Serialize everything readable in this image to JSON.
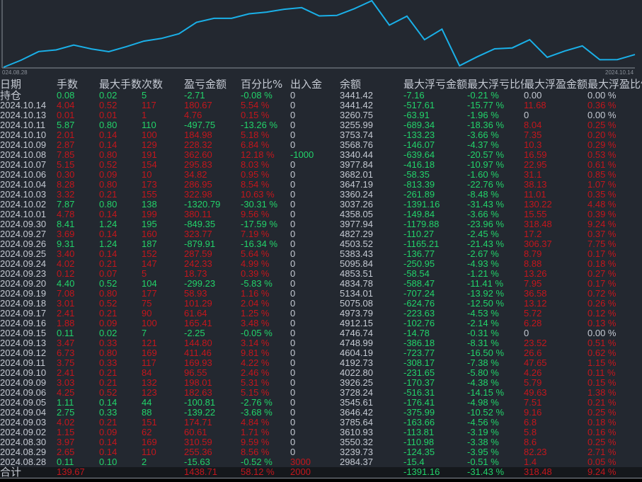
{
  "colors": {
    "bg": "#232830",
    "text": "#c5cad3",
    "up": "#c4161c",
    "down": "#22d36a",
    "line": "#1ab0e8",
    "total_bg": "#15181c"
  },
  "chart_data": {
    "type": "line",
    "title": "",
    "x_start_label": "024.08.28",
    "x_end_label": "2024.10.14",
    "series": [
      {
        "name": "余额",
        "source": "balance column (chronological)"
      }
    ],
    "grid": false
  },
  "headers": [
    "日期",
    "手数",
    "最大手数",
    "次数",
    "盈亏金额",
    "百分比%",
    "出入金",
    "余额",
    "最大浮亏金额",
    "最大浮亏比例",
    "最大浮盈金额",
    "最大浮盈比例"
  ],
  "rows": [
    [
      "持仓",
      "0.08",
      "0.02",
      "5",
      "-2.71",
      "-0.08 %",
      "0",
      "3441.42",
      "-7.16",
      "-0.21 %",
      "0.00",
      "0.00 %"
    ],
    [
      "2024.10.14",
      "4.04",
      "0.52",
      "117",
      "180.67",
      "5.54 %",
      "0",
      "3441.42",
      "-517.61",
      "-15.77 %",
      "11.68",
      "0.36 %"
    ],
    [
      "2024.10.13",
      "0.01",
      "0.01",
      "1",
      "4.76",
      "0.15 %",
      "0",
      "3260.75",
      "-63.91",
      "-1.96 %",
      "0",
      "0.00 %"
    ],
    [
      "2024.10.11",
      "5.87",
      "0.80",
      "110",
      "-497.75",
      "-13.26 %",
      "0",
      "3255.99",
      "-689.34",
      "-18.36 %",
      "8.04",
      "0.25 %"
    ],
    [
      "2024.10.10",
      "2.01",
      "0.14",
      "100",
      "184.98",
      "5.18 %",
      "0",
      "3753.74",
      "-133.23",
      "-3.66 %",
      "7.35",
      "0.20 %"
    ],
    [
      "2024.10.09",
      "2.87",
      "0.14",
      "129",
      "228.32",
      "6.84 %",
      "0",
      "3568.76",
      "-146.07",
      "-4.37 %",
      "10.3",
      "0.29 %"
    ],
    [
      "2024.10.08",
      "7.85",
      "0.80",
      "191",
      "362.60",
      "12.18 %",
      "-1000",
      "3340.44",
      "-639.64",
      "-20.57 %",
      "16.59",
      "0.53 %"
    ],
    [
      "2024.10.07",
      "5.15",
      "0.52",
      "154",
      "295.83",
      "8.03 %",
      "0",
      "3977.84",
      "-416.18",
      "-10.97 %",
      "22.95",
      "0.61 %"
    ],
    [
      "2024.10.06",
      "0.30",
      "0.09",
      "10",
      "34.82",
      "0.95 %",
      "0",
      "3682.01",
      "-58.35",
      "-1.60 %",
      "31.1",
      "0.85 %"
    ],
    [
      "2024.10.04",
      "8.28",
      "0.80",
      "173",
      "286.95",
      "8.54 %",
      "0",
      "3647.19",
      "-813.39",
      "-22.76 %",
      "38.13",
      "1.07 %"
    ],
    [
      "2024.10.03",
      "3.32",
      "0.21",
      "155",
      "322.98",
      "10.63 %",
      "0",
      "3360.24",
      "-261.89",
      "-8.48 %",
      "11.01",
      "0.35 %"
    ],
    [
      "2024.10.02",
      "7.87",
      "0.80",
      "138",
      "-1320.79",
      "-30.31 %",
      "0",
      "3037.26",
      "-1391.16",
      "-31.43 %",
      "130.22",
      "4.48 %"
    ],
    [
      "2024.10.01",
      "4.78",
      "0.14",
      "199",
      "380.11",
      "9.56 %",
      "0",
      "4358.05",
      "-149.84",
      "-3.66 %",
      "15.55",
      "0.39 %"
    ],
    [
      "2024.09.30",
      "8.41",
      "1.24",
      "195",
      "-849.35",
      "-17.59 %",
      "0",
      "3977.94",
      "-1179.88",
      "-23.96 %",
      "318.48",
      "9.24 %"
    ],
    [
      "2024.09.27",
      "3.69",
      "0.14",
      "160",
      "323.77",
      "7.19 %",
      "0",
      "4827.29",
      "-110.27",
      "-2.45 %",
      "17.2",
      "0.37 %"
    ],
    [
      "2024.09.26",
      "9.31",
      "1.24",
      "187",
      "-879.91",
      "-16.34 %",
      "0",
      "4503.52",
      "-1165.21",
      "-21.43 %",
      "306.37",
      "7.75 %"
    ],
    [
      "2024.09.25",
      "3.40",
      "0.14",
      "152",
      "287.59",
      "5.64 %",
      "0",
      "5383.43",
      "-136.77",
      "-2.67 %",
      "8.79",
      "0.17 %"
    ],
    [
      "2024.09.24",
      "4.02",
      "0.21",
      "147",
      "242.33",
      "4.99 %",
      "0",
      "5095.84",
      "-250.95",
      "-4.93 %",
      "8.88",
      "0.18 %"
    ],
    [
      "2024.09.23",
      "0.12",
      "0.07",
      "5",
      "18.73",
      "0.39 %",
      "0",
      "4853.51",
      "-58.54",
      "-1.21 %",
      "13.26",
      "0.27 %"
    ],
    [
      "2024.09.20",
      "4.40",
      "0.52",
      "104",
      "-299.23",
      "-5.83 %",
      "0",
      "4834.78",
      "-588.47",
      "-11.41 %",
      "7.95",
      "0.17 %"
    ],
    [
      "2024.09.19",
      "7.08",
      "0.80",
      "177",
      "58.93",
      "1.16 %",
      "0",
      "5134.01",
      "-707.24",
      "-13.92 %",
      "36.58",
      "0.72 %"
    ],
    [
      "2024.09.18",
      "3.01",
      "0.52",
      "75",
      "101.29",
      "2.04 %",
      "0",
      "5075.08",
      "-624.76",
      "-12.50 %",
      "13.12",
      "0.26 %"
    ],
    [
      "2024.09.17",
      "2.41",
      "0.21",
      "90",
      "61.64",
      "1.25 %",
      "0",
      "4973.79",
      "-223.63",
      "-4.53 %",
      "5.72",
      "0.12 %"
    ],
    [
      "2024.09.16",
      "1.88",
      "0.09",
      "100",
      "165.41",
      "3.48 %",
      "0",
      "4912.15",
      "-102.76",
      "-2.14 %",
      "6.28",
      "0.13 %"
    ],
    [
      "2024.09.15",
      "0.11",
      "0.02",
      "7",
      "-2.25",
      "-0.05 %",
      "0",
      "4746.74",
      "-14.78",
      "-0.31 %",
      "0",
      "0.00 %"
    ],
    [
      "2024.09.13",
      "3.47",
      "0.33",
      "121",
      "144.80",
      "3.14 %",
      "0",
      "4748.99",
      "-386.18",
      "-8.31 %",
      "23.52",
      "0.51 %"
    ],
    [
      "2024.09.12",
      "6.73",
      "0.80",
      "169",
      "411.46",
      "9.81 %",
      "0",
      "4604.19",
      "-723.77",
      "-16.50 %",
      "26.6",
      "0.62 %"
    ],
    [
      "2024.09.11",
      "3.75",
      "0.33",
      "117",
      "169.93",
      "4.22 %",
      "0",
      "4192.73",
      "-308.17",
      "-7.38 %",
      "47.65",
      "1.15 %"
    ],
    [
      "2024.09.10",
      "2.41",
      "0.21",
      "84",
      "96.55",
      "2.46 %",
      "0",
      "4022.80",
      "-231.65",
      "-5.80 %",
      "4.26",
      "0.11 %"
    ],
    [
      "2024.09.09",
      "3.03",
      "0.21",
      "132",
      "198.01",
      "5.31 %",
      "0",
      "3926.25",
      "-170.37",
      "-4.38 %",
      "5.79",
      "0.15 %"
    ],
    [
      "2024.09.06",
      "4.25",
      "0.52",
      "123",
      "182.63",
      "5.15 %",
      "0",
      "3728.24",
      "-516.31",
      "-14.15 %",
      "49.63",
      "1.38 %"
    ],
    [
      "2024.09.05",
      "1.11",
      "0.14",
      "44",
      "-100.81",
      "-2.76 %",
      "0",
      "3545.61",
      "-176.41",
      "-4.98 %",
      "7.51",
      "0.21 %"
    ],
    [
      "2024.09.04",
      "2.75",
      "0.33",
      "88",
      "-139.22",
      "-3.68 %",
      "0",
      "3646.42",
      "-375.99",
      "-10.52 %",
      "9.16",
      "0.25 %"
    ],
    [
      "2024.09.03",
      "4.02",
      "0.21",
      "151",
      "174.71",
      "4.84 %",
      "0",
      "3785.64",
      "-163.66",
      "-4.56 %",
      "6.8",
      "0.18 %"
    ],
    [
      "2024.09.02",
      "1.15",
      "0.09",
      "62",
      "60.61",
      "1.71 %",
      "0",
      "3610.93",
      "-113.81",
      "-3.19 %",
      "5.8",
      "0.16 %"
    ],
    [
      "2024.08.30",
      "3.97",
      "0.14",
      "169",
      "310.59",
      "9.59 %",
      "0",
      "3550.32",
      "-110.98",
      "-3.38 %",
      "8.6",
      "0.25 %"
    ],
    [
      "2024.08.29",
      "2.65",
      "0.14",
      "110",
      "255.36",
      "8.56 %",
      "0",
      "3239.73",
      "-124.35",
      "-3.95 %",
      "82.23",
      "2.71 %"
    ],
    [
      "2024.08.28",
      "0.11",
      "0.10",
      "2",
      "-15.63",
      "-0.52 %",
      "3000",
      "2984.37",
      "-15.4",
      "-0.51 %",
      "1.4",
      "0.05 %"
    ]
  ],
  "total": [
    "合计",
    "139.67",
    "",
    "",
    "1438.71",
    "58.12 %",
    "2000",
    "",
    "-1391.16",
    "-31.43 %",
    "318.48",
    "9.24 %"
  ]
}
